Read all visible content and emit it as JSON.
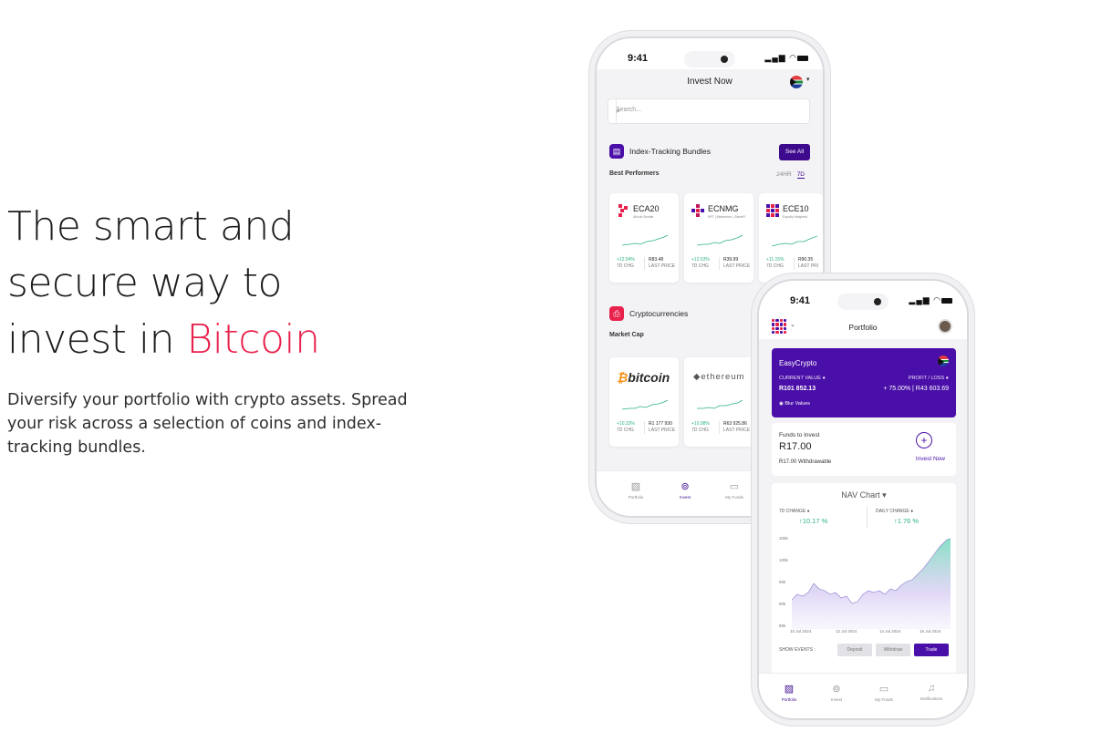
{
  "hero": {
    "line1": "The smart and",
    "line2": "secure way to",
    "line3_prefix": "invest in ",
    "line3_accent": "Bitcoin",
    "description": "Diversify your portfolio with crypto assets. Spread your risk across a selection of coins and index-tracking bundles."
  },
  "colors": {
    "accent": "#e8204c",
    "brand": "#4a0fa8",
    "positive": "#2db37c"
  },
  "phone1": {
    "time": "9:41",
    "title": "Invest Now",
    "search_placeholder": "Search...",
    "bundles": {
      "title": "Index-Tracking Bundles",
      "see_all": "See All",
      "sub": "Best Performers",
      "tf_24h": "24HR",
      "tf_7d": "7D",
      "cards": [
        {
          "name": "ECA20",
          "sub": "Altcoin Bundle",
          "chg": "+12.54%",
          "chg_label": "7D CHG",
          "price": "R83.48",
          "price_label": "LAST PRICE"
        },
        {
          "name": "ECNMG",
          "sub": "NFT | Metaverse | GameFi",
          "chg": "+12.53%",
          "chg_label": "7D CHG",
          "price": "R39.99",
          "price_label": "LAST PRICE"
        },
        {
          "name": "ECE10",
          "sub": "Equally Weighted",
          "chg": "+11.15%",
          "chg_label": "7D CHG",
          "price": "R90.35",
          "price_label": "LAST PRI"
        }
      ]
    },
    "crypto": {
      "title": "Cryptocurrencies",
      "sub": "Market Cap",
      "cards": [
        {
          "logo_text": "bitcoin",
          "chg": "+10.33%",
          "chg_label": "7D CHG",
          "price": "R1 177 930",
          "price_label": "LAST PRICE"
        },
        {
          "logo_text": "ethereum",
          "chg": "+10.98%",
          "chg_label": "7D CHG",
          "price": "R63 925.86",
          "price_label": "LAST PRICE"
        }
      ]
    },
    "tabs": [
      "Portfolio",
      "Invest",
      "My Funds"
    ]
  },
  "phone2": {
    "time": "9:41",
    "title": "Portfolio",
    "account": {
      "name": "EasyCrypto",
      "current_value_label": "CURRENT VALUE",
      "current_value": "R101 852.13",
      "pl_label": "PROFIT / LOSS",
      "pl_value": "+ 75.00% | R43 603.69",
      "blur_label": "Blur Values"
    },
    "funds": {
      "label": "Funds to Invest",
      "value": "R17.00",
      "withdrawable": "R17.00 Withdrawable",
      "invest_now": "Invest Now"
    },
    "nav": {
      "title": "NAV Chart",
      "change_7d_label": "7D CHANGE",
      "change_7d": "↑10.17 %",
      "daily_change_label": "DAILY CHANGE",
      "daily_change": "↑1.76 %",
      "y_ticks": [
        "105k",
        "100k",
        "95k",
        "90k",
        "85k"
      ],
      "x_ticks": [
        "10 Jul 2024",
        "12 Jul 2024",
        "14 Jul 2024",
        "16 Jul 2024"
      ],
      "show_events": "SHOW EVENTS :",
      "events": [
        "Deposit",
        "Withdraw",
        "Trade"
      ]
    },
    "tabs": [
      "Portfolio",
      "Invest",
      "My Funds",
      "Notifications"
    ]
  }
}
